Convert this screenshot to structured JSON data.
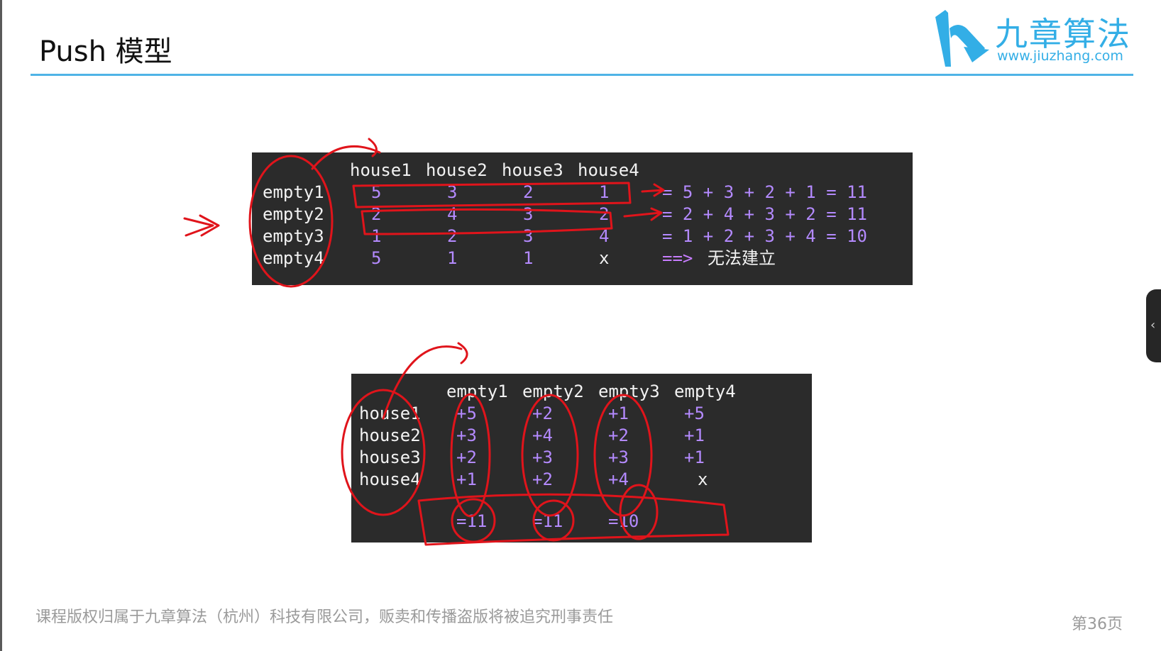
{
  "slide": {
    "title": "Push 模型",
    "logo_name": "九章算法",
    "logo_url": "www.jiuzhang.com",
    "footer": "课程版权归属于九章算法（杭州）科技有限公司，贩卖和传播盗版将被追究刑事责任",
    "page": "第36页"
  },
  "table1": {
    "headers": [
      "house1",
      "house2",
      "house3",
      "house4"
    ],
    "rows": [
      {
        "label": "empty1",
        "values": [
          "5",
          "3",
          "2",
          "1"
        ],
        "result": "= 5 + 3 + 2 + 1 = 11"
      },
      {
        "label": "empty2",
        "values": [
          "2",
          "4",
          "3",
          "2"
        ],
        "result": "= 2 + 4 + 3 + 2 = 11"
      },
      {
        "label": "empty3",
        "values": [
          "1",
          "2",
          "3",
          "4"
        ],
        "result": "= 1 + 2 + 3 + 4 = 10"
      },
      {
        "label": "empty4",
        "values": [
          "5",
          "1",
          "1",
          "x"
        ],
        "arrow": "==>",
        "result": "无法建立"
      }
    ]
  },
  "table2": {
    "headers": [
      "empty1",
      "empty2",
      "empty3",
      "empty4"
    ],
    "rows": [
      {
        "label": "house1",
        "values": [
          "+5",
          "+2",
          "+1",
          "+5"
        ]
      },
      {
        "label": "house2",
        "values": [
          "+3",
          "+4",
          "+2",
          "+1"
        ]
      },
      {
        "label": "house3",
        "values": [
          "+2",
          "+3",
          "+3",
          "+1"
        ]
      },
      {
        "label": "house4",
        "values": [
          "+1",
          "+2",
          "+4",
          "x"
        ]
      }
    ],
    "totals": [
      "=11",
      "=11",
      "=10"
    ]
  },
  "colors": {
    "accent": "#4fb3e6",
    "terminal_bg": "#2b2b2b",
    "number_color": "#b48aff",
    "annotation_ink": "#e0141b"
  },
  "icons": {
    "logo": "jiuzhang-logo-icon",
    "side_tab": "chevron-left-icon"
  }
}
